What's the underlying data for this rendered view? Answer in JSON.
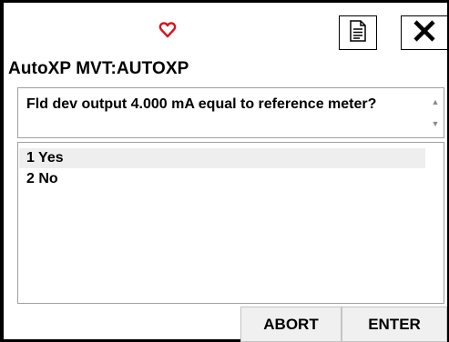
{
  "header": {
    "heart_icon": "heart-outline-icon",
    "heart_color": "#d9141c",
    "document_icon": "document-icon",
    "close_icon": "close-icon",
    "title": "AutoXP MVT:AUTOXP"
  },
  "prompt": {
    "question": "Fld dev output 4.000 mA equal to reference meter?"
  },
  "options": {
    "items": [
      {
        "label": "1 Yes"
      },
      {
        "label": "2 No"
      }
    ],
    "selected_index": 0
  },
  "buttons": {
    "abort_label": "ABORT",
    "enter_label": "ENTER"
  }
}
